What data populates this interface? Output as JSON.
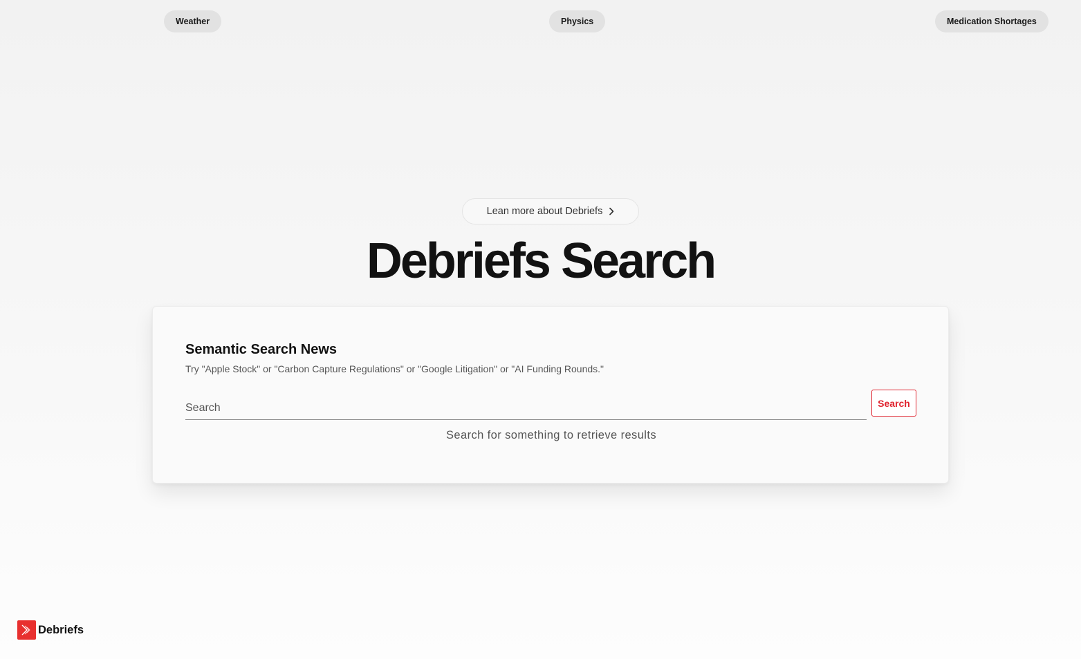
{
  "topics": [
    "Weather",
    "Physics",
    "Medication Shortages"
  ],
  "learn_more": {
    "label": "Lean more about Debriefs",
    "icon": "chevron-right-icon"
  },
  "hero": {
    "title": "Debriefs Search"
  },
  "search_card": {
    "title": "Semantic Search News",
    "subtitle": "Try \"Apple Stock\" or \"Carbon Capture Regulations\" or \"Google Litigation\" or \"AI Funding Rounds.\"",
    "input_placeholder": "Search",
    "input_value": "",
    "button_label": "Search",
    "empty_message": "Search for something to retrieve results"
  },
  "brand": {
    "name": "Debriefs",
    "logo_icon": "debriefs-logo-icon"
  },
  "colors": {
    "accent": "#e0242f",
    "chip_bg": "#e2e2e2",
    "page_bg": "#f4f4f4"
  }
}
